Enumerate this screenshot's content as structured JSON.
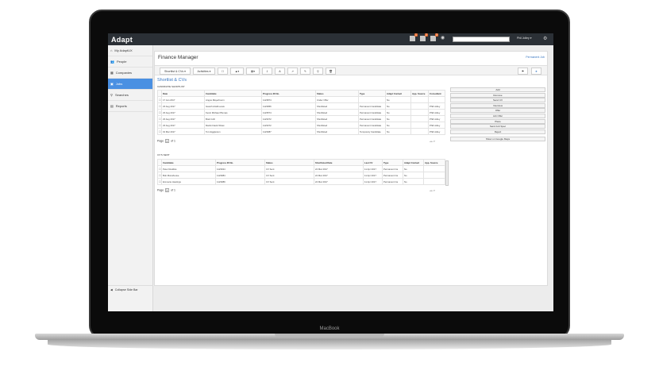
{
  "app": {
    "logo": "Adapt"
  },
  "topbar": {
    "badges": [
      "1",
      "2",
      "3"
    ],
    "user": "Phil Jolley ▾",
    "search_placeholder": ""
  },
  "sidebar": {
    "items": [
      {
        "label": "My AdaptUX",
        "icon": "home-icon"
      },
      {
        "label": "People",
        "icon": "people-icon"
      },
      {
        "label": "Companies",
        "icon": "companies-icon"
      },
      {
        "label": "Jobs",
        "icon": "jobs-icon",
        "active": true
      },
      {
        "label": "Searches",
        "icon": "search-icon"
      },
      {
        "label": "Reports",
        "icon": "reports-icon"
      }
    ],
    "collapse": "Collapse Side Bar"
  },
  "page": {
    "title": "Finance Manager",
    "permanent_link": "Permanent Job"
  },
  "toolbar": {
    "shortlist": "Shortlist & CVs ▾",
    "activities": "Activities ▾",
    "icons": [
      "☐",
      "▲▾",
      "▤▾",
      "⇩",
      "A",
      "↗",
      "✎",
      "⚲",
      "🗑",
      "⚑",
      "★"
    ]
  },
  "section_title": "Shortlist & CVs",
  "candidate_shortlist_label": "CANDIDATE SHORTLIST",
  "shortlist_table": {
    "headers": [
      "",
      "Date",
      "Candidate",
      "Progress ID No.",
      "Status",
      "Type",
      "Adapt Contact",
      "App. Source",
      "Consultant"
    ],
    "rows": [
      [
        "☐",
        "17 Jan 2017",
        "Angus Mayerbourn",
        "1123874",
        "Under Offer",
        "",
        "No",
        "",
        ""
      ],
      [
        "☐",
        "23 Aug 2017",
        "Gareth Atwill-Lewis",
        "1123956",
        "Shortlisted",
        "Permanent Candidate",
        "No",
        "",
        "Phill Jolley"
      ],
      [
        "☐",
        "23 Aug 2017",
        "Kevin Michael Plumas",
        "1123574",
        "Shortlisted",
        "Permanent Candidate",
        "No",
        "",
        "Phill Jolley"
      ],
      [
        "☐",
        "23 Aug 2017",
        "Brett Grill",
        "1123372",
        "Shortlisted",
        "Permanent Candidate",
        "No",
        "",
        "Phill Jolley"
      ],
      [
        "☐",
        "23 Aug 2017",
        "Martin David Shaw",
        "1123372",
        "Shortlisted",
        "Permanent Candidate",
        "No",
        "",
        "Phill Jolley"
      ],
      [
        "☐",
        "19 Mar 2017",
        "Tom Eggleston",
        "1123087",
        "Shortlisted",
        "Temporary Candidate",
        "No",
        "",
        "Phill Jolley"
      ]
    ]
  },
  "pager1": {
    "page_label": "Page",
    "page": "1",
    "of": "of 1"
  },
  "cvs_label": "CV'S SENT",
  "cv_table": {
    "headers": [
      "",
      "Candidate",
      "Progress ID No.",
      "Status",
      "Shortlisted Date",
      "Last CV",
      "Type",
      "Adapt Contact",
      "App. Source"
    ],
    "rows": [
      [
        "☐",
        "Peter Reddiss",
        "1123024",
        "CV Sent",
        "24 Mar 2017",
        "11 Apr 2017",
        "Permanent Ca",
        "No",
        ""
      ],
      [
        "☐",
        "Bob Monahouse",
        "1123084",
        "CV Sent",
        "24 Mar 2017",
        "11 Apr 2017",
        "Permanent Ca",
        "No",
        ""
      ],
      [
        "☐",
        "Emmerie Hastings",
        "1123089",
        "CV Sent",
        "24 Mar 2017",
        "11 Apr 2017",
        "Permanent Ca",
        "No",
        ""
      ]
    ]
  },
  "pager2": {
    "page_label": "Page",
    "page": "1",
    "of": "of 1"
  },
  "actions": [
    "Add",
    "Remove",
    "Send CV",
    "Interview",
    "Offer",
    "Job Offer",
    "Place",
    "Send Job Spec",
    "Reject"
  ],
  "google_maps": "Show on Google Maps",
  "laptop": {
    "brand": "MacBook"
  },
  "colors": {
    "accent": "#4a90e2",
    "topbar": "#2b3036",
    "badge": "#e2672a",
    "link": "#3b78c2"
  }
}
